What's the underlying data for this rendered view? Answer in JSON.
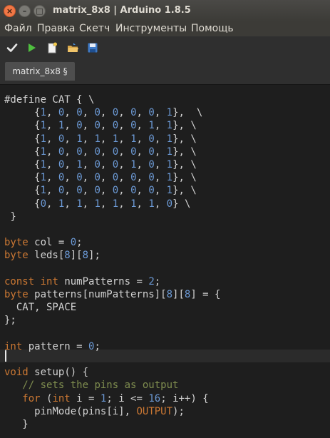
{
  "window": {
    "title": "matrix_8x8 | Arduino 1.8.5",
    "close_glyph": "×",
    "min_glyph": "–",
    "max_glyph": "□"
  },
  "menu": [
    "Файл",
    "Правка",
    "Скетч",
    "Инструменты",
    "Помощь"
  ],
  "toolbar": {
    "icons": [
      "verify-icon",
      "upload-icon",
      "new-icon",
      "open-icon",
      "save-icon"
    ]
  },
  "tab": {
    "label": "matrix_8x8 §"
  },
  "code": [
    [
      [
        "",
        "#define CAT { \\"
      ]
    ],
    [
      [
        "",
        "     "
      ],
      [
        "",
        "{"
      ],
      [
        "num",
        "1"
      ],
      [
        "",
        ", "
      ],
      [
        "num",
        "0"
      ],
      [
        "",
        ", "
      ],
      [
        "num",
        "0"
      ],
      [
        "",
        ", "
      ],
      [
        "num",
        "0"
      ],
      [
        "",
        ", "
      ],
      [
        "num",
        "0"
      ],
      [
        "",
        ", "
      ],
      [
        "num",
        "0"
      ],
      [
        "",
        ", "
      ],
      [
        "num",
        "0"
      ],
      [
        "",
        ", "
      ],
      [
        "num",
        "1"
      ],
      [
        "",
        "},  \\"
      ]
    ],
    [
      [
        "",
        "     "
      ],
      [
        "",
        "{"
      ],
      [
        "num",
        "1"
      ],
      [
        "",
        ", "
      ],
      [
        "num",
        "1"
      ],
      [
        "",
        ", "
      ],
      [
        "num",
        "0"
      ],
      [
        "",
        ", "
      ],
      [
        "num",
        "0"
      ],
      [
        "",
        ", "
      ],
      [
        "num",
        "0"
      ],
      [
        "",
        ", "
      ],
      [
        "num",
        "0"
      ],
      [
        "",
        ", "
      ],
      [
        "num",
        "1"
      ],
      [
        "",
        ", "
      ],
      [
        "num",
        "1"
      ],
      [
        "",
        "}, \\"
      ]
    ],
    [
      [
        "",
        "     "
      ],
      [
        "",
        "{"
      ],
      [
        "num",
        "1"
      ],
      [
        "",
        ", "
      ],
      [
        "num",
        "0"
      ],
      [
        "",
        ", "
      ],
      [
        "num",
        "1"
      ],
      [
        "",
        ", "
      ],
      [
        "num",
        "1"
      ],
      [
        "",
        ", "
      ],
      [
        "num",
        "1"
      ],
      [
        "",
        ", "
      ],
      [
        "num",
        "1"
      ],
      [
        "",
        ", "
      ],
      [
        "num",
        "0"
      ],
      [
        "",
        ", "
      ],
      [
        "num",
        "1"
      ],
      [
        "",
        "}, \\"
      ]
    ],
    [
      [
        "",
        "     "
      ],
      [
        "",
        "{"
      ],
      [
        "num",
        "1"
      ],
      [
        "",
        ", "
      ],
      [
        "num",
        "0"
      ],
      [
        "",
        ", "
      ],
      [
        "num",
        "0"
      ],
      [
        "",
        ", "
      ],
      [
        "num",
        "0"
      ],
      [
        "",
        ", "
      ],
      [
        "num",
        "0"
      ],
      [
        "",
        ", "
      ],
      [
        "num",
        "0"
      ],
      [
        "",
        ", "
      ],
      [
        "num",
        "0"
      ],
      [
        "",
        ", "
      ],
      [
        "num",
        "1"
      ],
      [
        "",
        "}, \\"
      ]
    ],
    [
      [
        "",
        "     "
      ],
      [
        "",
        "{"
      ],
      [
        "num",
        "1"
      ],
      [
        "",
        ", "
      ],
      [
        "num",
        "0"
      ],
      [
        "",
        ", "
      ],
      [
        "num",
        "1"
      ],
      [
        "",
        ", "
      ],
      [
        "num",
        "0"
      ],
      [
        "",
        ", "
      ],
      [
        "num",
        "0"
      ],
      [
        "",
        ", "
      ],
      [
        "num",
        "1"
      ],
      [
        "",
        ", "
      ],
      [
        "num",
        "0"
      ],
      [
        "",
        ", "
      ],
      [
        "num",
        "1"
      ],
      [
        "",
        "}, \\"
      ]
    ],
    [
      [
        "",
        "     "
      ],
      [
        "",
        "{"
      ],
      [
        "num",
        "1"
      ],
      [
        "",
        ", "
      ],
      [
        "num",
        "0"
      ],
      [
        "",
        ", "
      ],
      [
        "num",
        "0"
      ],
      [
        "",
        ", "
      ],
      [
        "num",
        "0"
      ],
      [
        "",
        ", "
      ],
      [
        "num",
        "0"
      ],
      [
        "",
        ", "
      ],
      [
        "num",
        "0"
      ],
      [
        "",
        ", "
      ],
      [
        "num",
        "0"
      ],
      [
        "",
        ", "
      ],
      [
        "num",
        "1"
      ],
      [
        "",
        "}, \\"
      ]
    ],
    [
      [
        "",
        "     "
      ],
      [
        "",
        "{"
      ],
      [
        "num",
        "1"
      ],
      [
        "",
        ", "
      ],
      [
        "num",
        "0"
      ],
      [
        "",
        ", "
      ],
      [
        "num",
        "0"
      ],
      [
        "",
        ", "
      ],
      [
        "num",
        "0"
      ],
      [
        "",
        ", "
      ],
      [
        "num",
        "0"
      ],
      [
        "",
        ", "
      ],
      [
        "num",
        "0"
      ],
      [
        "",
        ", "
      ],
      [
        "num",
        "0"
      ],
      [
        "",
        ", "
      ],
      [
        "num",
        "1"
      ],
      [
        "",
        "}, \\"
      ]
    ],
    [
      [
        "",
        "     "
      ],
      [
        "",
        "{"
      ],
      [
        "num",
        "0"
      ],
      [
        "",
        ", "
      ],
      [
        "num",
        "1"
      ],
      [
        "",
        ", "
      ],
      [
        "num",
        "1"
      ],
      [
        "",
        ", "
      ],
      [
        "num",
        "1"
      ],
      [
        "",
        ", "
      ],
      [
        "num",
        "1"
      ],
      [
        "",
        ", "
      ],
      [
        "num",
        "1"
      ],
      [
        "",
        ", "
      ],
      [
        "num",
        "1"
      ],
      [
        "",
        ", "
      ],
      [
        "num",
        "0"
      ],
      [
        "",
        "} \\"
      ]
    ],
    [
      [
        "",
        " }"
      ]
    ],
    [],
    [
      [
        "ty",
        "byte"
      ],
      [
        "",
        " col = "
      ],
      [
        "num",
        "0"
      ],
      [
        "",
        ";"
      ]
    ],
    [
      [
        "ty",
        "byte"
      ],
      [
        "",
        " leds["
      ],
      [
        "num",
        "8"
      ],
      [
        "",
        "]["
      ],
      [
        "num",
        "8"
      ],
      [
        "",
        "];"
      ]
    ],
    [],
    [
      [
        "kw",
        "const"
      ],
      [
        "",
        " "
      ],
      [
        "ty",
        "int"
      ],
      [
        "",
        " numPatterns = "
      ],
      [
        "num",
        "2"
      ],
      [
        "",
        ";"
      ]
    ],
    [
      [
        "ty",
        "byte"
      ],
      [
        "",
        " patterns[numPatterns]["
      ],
      [
        "num",
        "8"
      ],
      [
        "",
        "]["
      ],
      [
        "num",
        "8"
      ],
      [
        "",
        "] = {"
      ]
    ],
    [
      [
        "",
        "  CAT, SPACE"
      ]
    ],
    [
      [
        "",
        "};"
      ]
    ],
    [],
    [
      [
        "ty",
        "int"
      ],
      [
        "",
        " pattern = "
      ],
      [
        "num",
        "0"
      ],
      [
        "",
        ";"
      ]
    ],
    [],
    [
      [
        "ty",
        "void"
      ],
      [
        "",
        " "
      ],
      [
        "fn",
        "setup"
      ],
      [
        "",
        "() {"
      ]
    ],
    [
      [
        "",
        "   "
      ],
      [
        "cm",
        "// sets the pins as output"
      ]
    ],
    [
      [
        "",
        "   "
      ],
      [
        "kw",
        "for"
      ],
      [
        "",
        " ("
      ],
      [
        "ty",
        "int"
      ],
      [
        "",
        " i = "
      ],
      [
        "num",
        "1"
      ],
      [
        "",
        "; i <= "
      ],
      [
        "num",
        "16"
      ],
      [
        "",
        "; i++) {"
      ]
    ],
    [
      [
        "",
        "     "
      ],
      [
        "fn",
        "pinMode"
      ],
      [
        "",
        "(pins[i], "
      ],
      [
        "cst",
        "OUTPUT"
      ],
      [
        "",
        ");"
      ]
    ],
    [
      [
        "",
        "   }"
      ]
    ]
  ]
}
